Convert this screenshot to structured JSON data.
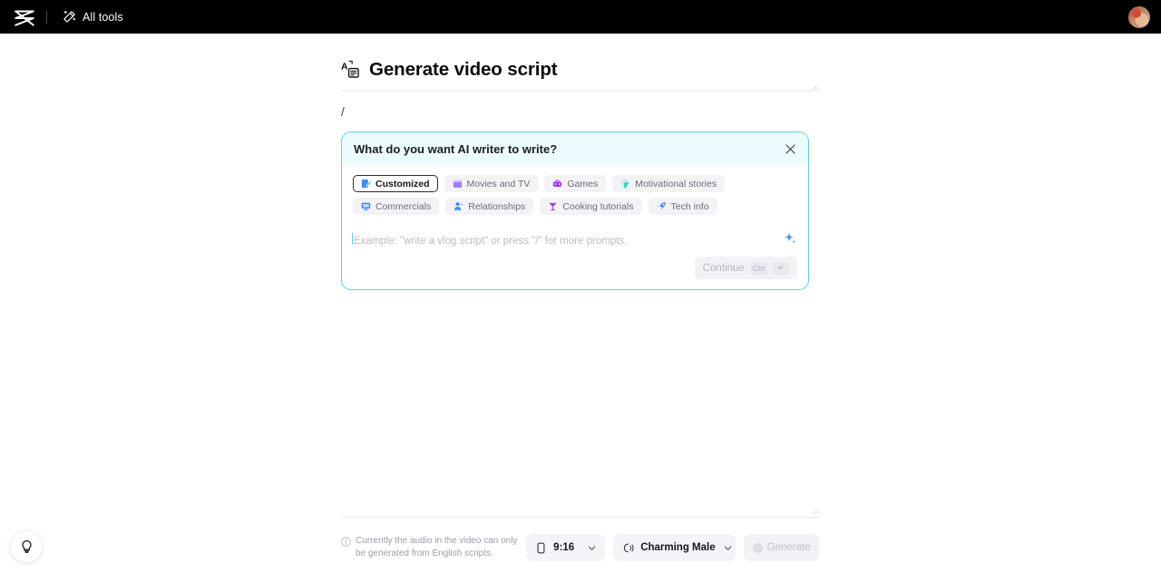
{
  "topbar": {
    "logo_icon": "capcut-logo-icon",
    "wand_icon": "magic-wand-icon",
    "all_tools_label": "All tools",
    "avatar_name": "user-avatar"
  },
  "page": {
    "title": "Generate video script",
    "title_icon": "script-text-icon"
  },
  "editor": {
    "typed_text": "/"
  },
  "prompt_panel": {
    "heading": "What do you want AI writer to write?",
    "close_icon": "close-icon",
    "accent_color": "#5bcfdc",
    "header_bg": "#ecfbfd",
    "chips": [
      {
        "label": "Customized",
        "icon": "edit-document-icon",
        "selected": true
      },
      {
        "label": "Movies and TV",
        "icon": "clapperboard-icon",
        "selected": false
      },
      {
        "label": "Games",
        "icon": "gamepad-icon",
        "selected": false
      },
      {
        "label": "Motivational stories",
        "icon": "raised-hand-icon",
        "selected": false
      },
      {
        "label": "Commercials",
        "icon": "monitor-icon",
        "selected": false
      },
      {
        "label": "Relationships",
        "icon": "person-icon",
        "selected": false
      },
      {
        "label": "Cooking tutorials",
        "icon": "cocktail-glass-icon",
        "selected": false
      },
      {
        "label": "Tech info",
        "icon": "rocket-icon",
        "selected": false
      }
    ],
    "input": {
      "value": "",
      "placeholder": "Example: \"write a vlog script\" or press \"/\" for more prompts.",
      "sparkle_icon": "ai-sparkle-icon"
    },
    "continue": {
      "label": "Continue",
      "key_modifier": "Ctrl",
      "key_enter": "↵",
      "disabled": true
    }
  },
  "footer": {
    "info_icon": "info-circle-icon",
    "notice": "Currently the audio in the video can only be generated from English scripts.",
    "aspect_ratio": {
      "icon": "phone-portrait-icon",
      "value": "9:16",
      "chevron": "chevron-down-icon"
    },
    "voice": {
      "icon": "voice-wave-icon",
      "value": "Charming Male",
      "chevron": "chevron-down-icon"
    },
    "generate": {
      "icon": "credit-coin-icon",
      "label": "Generate",
      "disabled": true
    }
  },
  "tips_fab": {
    "icon": "lightbulb-icon"
  }
}
